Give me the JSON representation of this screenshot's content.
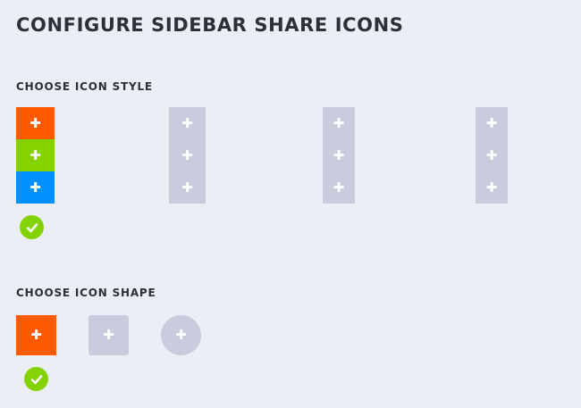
{
  "page": {
    "title": "CONFIGURE SIDEBAR SHARE ICONS"
  },
  "icon_style": {
    "heading": "CHOOSE ICON STYLE",
    "selected_option": 1,
    "options": [
      {
        "name": "colored",
        "selected": true,
        "cells": [
          {
            "icon": "plus-icon",
            "glyph": "✚",
            "color": "#ff5a00"
          },
          {
            "icon": "plus-icon",
            "glyph": "✚",
            "color": "#84d300"
          },
          {
            "icon": "plus-icon",
            "glyph": "✚",
            "color": "#0090ff"
          }
        ]
      },
      {
        "name": "grey",
        "selected": false,
        "cells": [
          {
            "icon": "plus-icon",
            "glyph": "✚",
            "color": "#c8ccdd"
          },
          {
            "icon": "plus-icon",
            "glyph": "✚",
            "color": "#c8ccdd"
          },
          {
            "icon": "plus-icon",
            "glyph": "✚",
            "color": "#c8ccdd"
          }
        ]
      },
      {
        "name": "grey",
        "selected": false,
        "cells": [
          {
            "icon": "plus-icon",
            "glyph": "✚",
            "color": "#c8ccdd"
          },
          {
            "icon": "plus-icon",
            "glyph": "✚",
            "color": "#c8ccdd"
          },
          {
            "icon": "plus-icon",
            "glyph": "✚",
            "color": "#c8ccdd"
          }
        ]
      },
      {
        "name": "grey",
        "selected": false,
        "cells": [
          {
            "icon": "plus-icon",
            "glyph": "✚",
            "color": "#c8ccdd"
          },
          {
            "icon": "plus-icon",
            "glyph": "✚",
            "color": "#c8ccdd"
          },
          {
            "icon": "plus-icon",
            "glyph": "✚",
            "color": "#c8ccdd"
          }
        ]
      }
    ]
  },
  "icon_shape": {
    "heading": "CHOOSE ICON SHAPE",
    "selected_option": 1,
    "options": [
      {
        "shape": "square",
        "selected": true,
        "icon": "plus-icon",
        "glyph": "✚",
        "color": "#ff5a00"
      },
      {
        "shape": "rounded",
        "selected": false,
        "icon": "plus-icon",
        "glyph": "✚",
        "color": "#c8ccdd"
      },
      {
        "shape": "circle",
        "selected": false,
        "icon": "plus-icon",
        "glyph": "✚",
        "color": "#c8ccdd"
      }
    ]
  },
  "selection_indicator": {
    "icon": "checkmark-icon",
    "color": "#84d300"
  },
  "colors": {
    "background": "#eceef6",
    "text": "#2f2f3a"
  }
}
